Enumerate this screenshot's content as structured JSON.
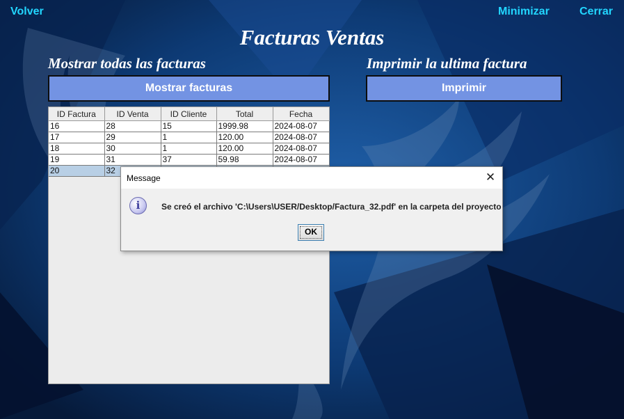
{
  "nav": {
    "back_label": "Volver",
    "minimize_label": "Minimizar",
    "close_label": "Cerrar"
  },
  "page_title": "Facturas Ventas",
  "left_section": {
    "heading": "Mostrar todas las facturas",
    "button_label": "Mostrar facturas"
  },
  "right_section": {
    "heading": "Imprimir la ultima factura",
    "button_label": "Imprimir"
  },
  "table": {
    "columns": [
      "ID Factura",
      "ID Venta",
      "ID Cliente",
      "Total",
      "Fecha"
    ],
    "rows": [
      [
        "16",
        "28",
        "15",
        "1999.98",
        "2024-08-07"
      ],
      [
        "17",
        "29",
        "1",
        "120.00",
        "2024-08-07"
      ],
      [
        "18",
        "30",
        "1",
        "120.00",
        "2024-08-07"
      ],
      [
        "19",
        "31",
        "37",
        "59.98",
        "2024-08-07"
      ],
      [
        "20",
        "32",
        "",
        "",
        ""
      ]
    ],
    "selected_row_index": 4
  },
  "dialog": {
    "title": "Message",
    "close_glyph": "✕",
    "icon": "info-icon",
    "icon_glyph": "i",
    "message": "Se creó el archivo 'C:\\Users\\USER/Desktop/Factura_32.pdf' en la carpeta del proyecto",
    "ok_label": "OK"
  },
  "colors": {
    "accent_link": "#22d6ff",
    "button_bg": "#7393e3",
    "background": "#0a2a55"
  }
}
